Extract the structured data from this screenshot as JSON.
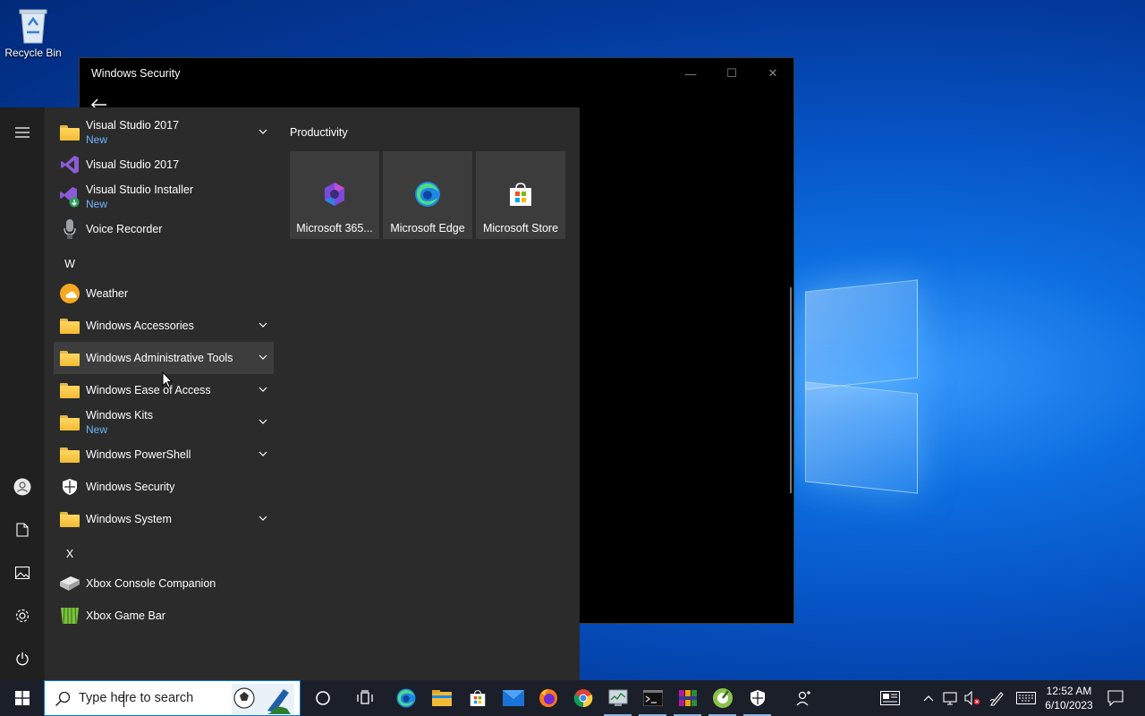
{
  "desktop": {
    "recycle_bin_label": "Recycle Bin"
  },
  "security_window": {
    "title": "Windows Security",
    "controls": {
      "minimize": "—",
      "maximize": "☐",
      "close": "✕"
    }
  },
  "start_menu": {
    "apps": [
      {
        "name": "Visual Studio 2017",
        "sub": "New",
        "icon": "folder-icon",
        "expandable": true
      },
      {
        "name": "Visual Studio 2017",
        "sub": "",
        "icon": "visual-studio-icon",
        "expandable": false
      },
      {
        "name": "Visual Studio Installer",
        "sub": "New",
        "icon": "visual-studio-installer-icon",
        "expandable": false
      },
      {
        "name": "Voice Recorder",
        "sub": "",
        "icon": "microphone-icon",
        "expandable": false
      },
      {
        "name": "Weather",
        "sub": "",
        "icon": "weather-icon",
        "expandable": false
      },
      {
        "name": "Windows Accessories",
        "sub": "",
        "icon": "folder-icon",
        "expandable": true
      },
      {
        "name": "Windows Administrative Tools",
        "sub": "",
        "icon": "folder-icon",
        "expandable": true
      },
      {
        "name": "Windows Ease of Access",
        "sub": "",
        "icon": "folder-icon",
        "expandable": true
      },
      {
        "name": "Windows Kits",
        "sub": "New",
        "icon": "folder-icon",
        "expandable": true
      },
      {
        "name": "Windows PowerShell",
        "sub": "",
        "icon": "folder-icon",
        "expandable": true
      },
      {
        "name": "Windows Security",
        "sub": "",
        "icon": "shield-icon",
        "expandable": false
      },
      {
        "name": "Windows System",
        "sub": "",
        "icon": "folder-icon",
        "expandable": true
      },
      {
        "name": "Xbox Console Companion",
        "sub": "",
        "icon": "xbox-console-icon",
        "expandable": false
      },
      {
        "name": "Xbox Game Bar",
        "sub": "",
        "icon": "xbox-game-bar-icon",
        "expandable": false
      }
    ],
    "letters": {
      "w": "W",
      "x": "X"
    },
    "tiles_group": "Productivity",
    "tiles": [
      {
        "label": "Microsoft 365...",
        "icon": "microsoft-365-icon"
      },
      {
        "label": "Microsoft Edge",
        "icon": "edge-icon"
      },
      {
        "label": "Microsoft Store",
        "icon": "store-icon"
      }
    ],
    "rail": [
      "hamburger-icon",
      "user-icon",
      "document-icon",
      "pictures-icon",
      "settings-icon",
      "power-icon"
    ]
  },
  "taskbar": {
    "search_placeholder": "Type here to search",
    "apps": [
      "cortana",
      "task-view",
      "edge",
      "file-explorer",
      "store",
      "mail",
      "firefox",
      "chrome",
      "performance-monitor",
      "terminal",
      "winrar",
      "app",
      "windows-security",
      "people"
    ],
    "clock": {
      "time": "12:52 AM",
      "date": "6/10/2023"
    }
  },
  "colors": {
    "accent": "#0078d7",
    "new_badge": "#6cb6ff",
    "start_bg": "#2b2b2b",
    "taskbar_bg": "#1b1f2a"
  }
}
